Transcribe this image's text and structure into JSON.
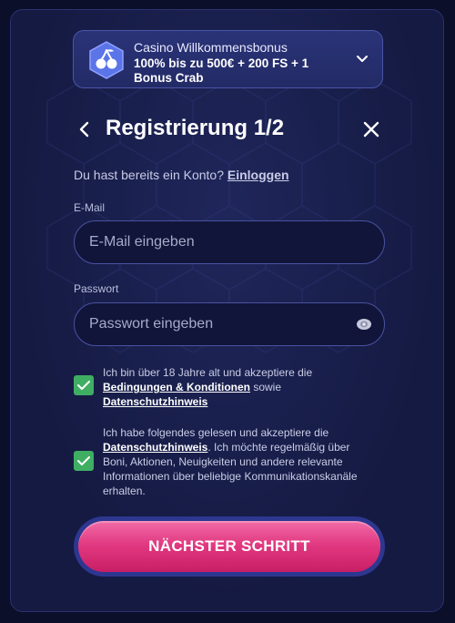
{
  "bonus": {
    "title": "Casino Willkommensbonus",
    "description": "100% bis zu 500€ + 200 FS + 1 Bonus Crab"
  },
  "header": {
    "title": "Registrierung 1/2"
  },
  "login": {
    "prompt": "Du hast bereits ein Konto?",
    "link": "Einloggen"
  },
  "email": {
    "label": "E-Mail",
    "placeholder": "E-Mail eingeben",
    "value": ""
  },
  "password": {
    "label": "Passwort",
    "placeholder": "Passwort eingeben",
    "value": ""
  },
  "consent1": {
    "checked": true,
    "text_before": "Ich bin über 18 Jahre alt und akzeptiere die",
    "link1": "Bedingungen & Konditionen",
    "between": "sowie",
    "link2": "Datenschutzhinweis"
  },
  "consent2": {
    "checked": true,
    "text_before": "Ich habe folgendes gelesen und akzeptiere die",
    "link": "Datenschutzhinweis",
    "text_after": ". Ich möchte regelmäßig über Boni, Aktionen, Neuigkeiten und andere relevante Informationen über beliebige Kommunikationskanäle erhalten."
  },
  "cta": {
    "label": "NÄCHSTER SCHRITT"
  },
  "colors": {
    "accent": "#e23a82",
    "checkbox": "#3fae63",
    "background": "#151a42"
  },
  "icons": {
    "bonus": "cherry-icon",
    "chevron": "chevron-down-icon",
    "back": "chevron-left-icon",
    "close": "close-icon",
    "eye": "eye-icon",
    "check": "checkmark-icon"
  }
}
